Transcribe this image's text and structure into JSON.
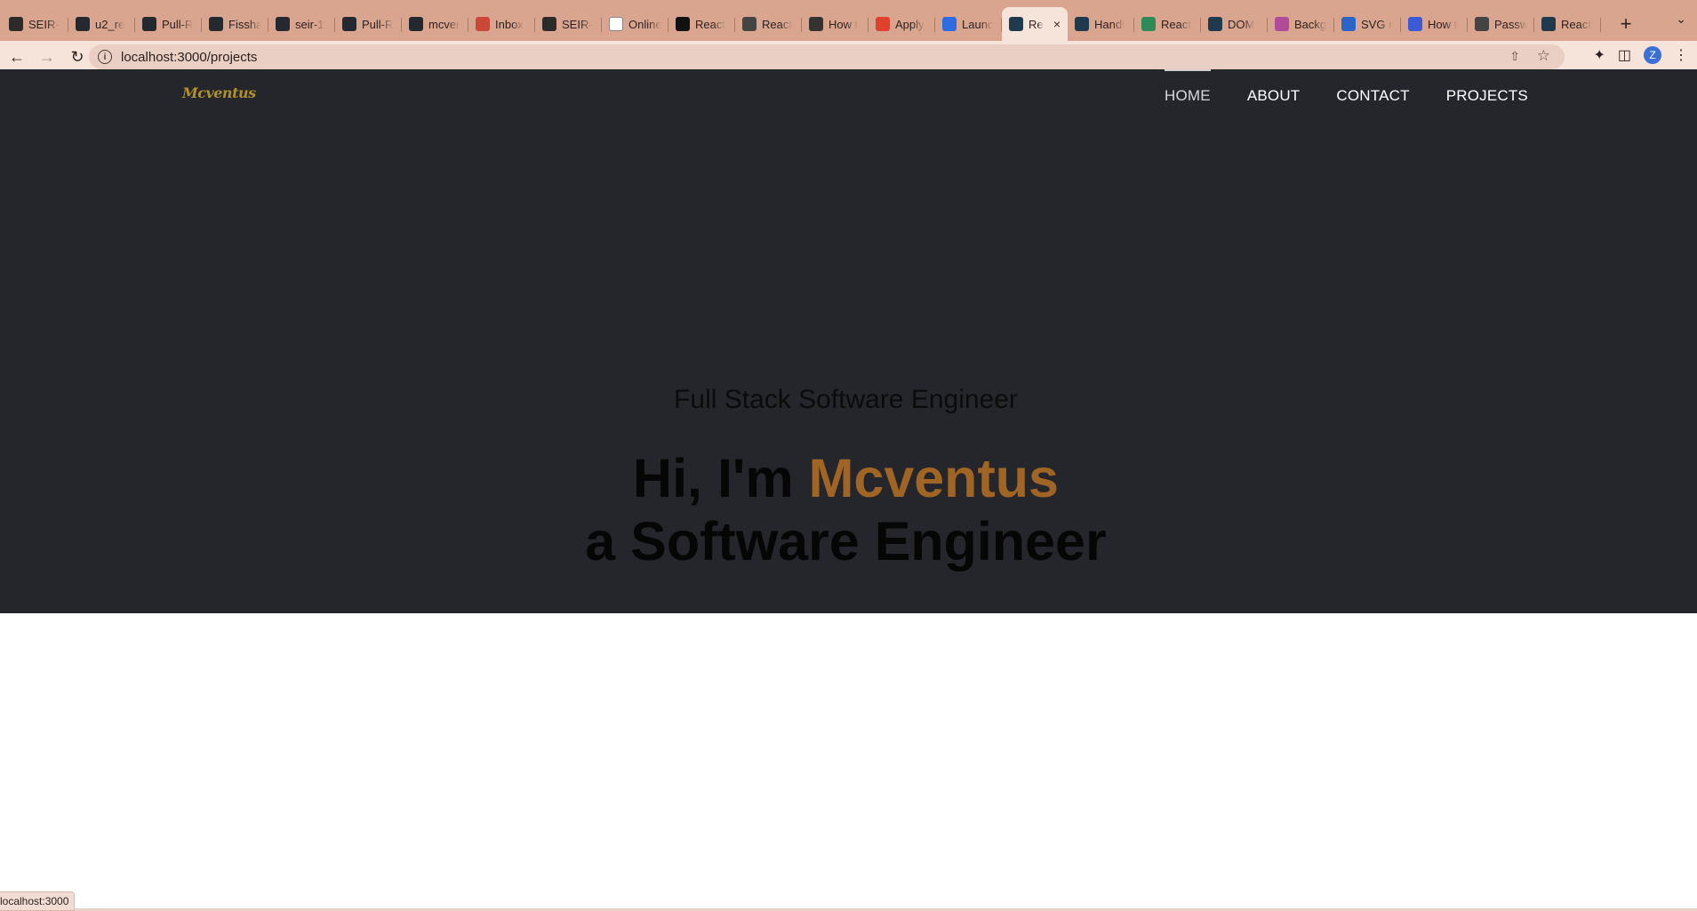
{
  "browser": {
    "tabs": [
      {
        "label": "SEIR-",
        "color": "#2d2a2a"
      },
      {
        "label": "u2_re",
        "color": "#24292f"
      },
      {
        "label": "Pull-R",
        "color": "#24292f"
      },
      {
        "label": "Fissha",
        "color": "#24292f"
      },
      {
        "label": "seir-1",
        "color": "#24292f"
      },
      {
        "label": "Pull-R",
        "color": "#24292f"
      },
      {
        "label": "mcver",
        "color": "#24292f"
      },
      {
        "label": "Inbox",
        "color": "#c9483a"
      },
      {
        "label": "SEIR-",
        "color": "#2d2a2a"
      },
      {
        "label": "Online",
        "color": "#ffffff"
      },
      {
        "label": "React",
        "color": "#111111"
      },
      {
        "label": "React",
        "color": "#444444"
      },
      {
        "label": "How t",
        "color": "#333333"
      },
      {
        "label": "Apply",
        "color": "#e0412f"
      },
      {
        "label": "Launc",
        "color": "#2d6ce0"
      },
      {
        "label": "Re",
        "color": "#1f3a4d",
        "active": true
      },
      {
        "label": "Handl",
        "color": "#1f3a4d"
      },
      {
        "label": "React",
        "color": "#2e8b57"
      },
      {
        "label": "DOM",
        "color": "#1f3a4d"
      },
      {
        "label": "Backg",
        "color": "#b24a9a"
      },
      {
        "label": "SVG r",
        "color": "#2a66c8"
      },
      {
        "label": "How t",
        "color": "#3b5ad8"
      },
      {
        "label": "Passw",
        "color": "#444444"
      },
      {
        "label": "React",
        "color": "#1f3a4d"
      }
    ],
    "url": "localhost:3000/projects",
    "status_url": "localhost:3000",
    "profile_initial": "Z"
  },
  "site": {
    "brand": "Mcventus",
    "nav": [
      {
        "label": "HOME",
        "active": true
      },
      {
        "label": "ABOUT"
      },
      {
        "label": "CONTACT"
      },
      {
        "label": "PROJECTS"
      }
    ],
    "hero": {
      "subtitle": "Full Stack Software Engineer",
      "greeting": "Hi, I'm ",
      "name": "Mcventus",
      "line2": "a Software Engineer"
    }
  },
  "colors": {
    "hero_bg": "#25262c",
    "brand": "#b0902a",
    "name_accent": "#a06424",
    "browser_frame": "#d9a58e"
  }
}
